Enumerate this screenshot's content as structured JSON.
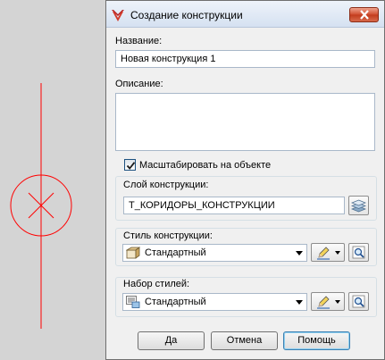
{
  "window": {
    "title": "Создание конструкции"
  },
  "fields": {
    "name_label": "Название:",
    "name_value": "Новая конструкция 1",
    "description_label": "Описание:",
    "description_value": "",
    "scale_checkbox_label": "Масштабировать на объекте",
    "scale_checked": true,
    "layer_label": "Слой конструкции:",
    "layer_value": "Т_КОРИДОРЫ_КОНСТРУКЦИИ",
    "style_label": "Стиль конструкции:",
    "style_value": "Стандартный",
    "styleset_label": "Набор стилей:",
    "styleset_value": "Стандартный"
  },
  "buttons": {
    "ok": "Да",
    "cancel": "Отмена",
    "help": "Помощь"
  },
  "icons": {
    "app": "civil3d-app-icon",
    "close": "close-icon",
    "layer": "layers-icon",
    "style": "structure-style-icon",
    "styleset": "style-set-icon",
    "edit": "pencil-edit-icon",
    "preview": "magnifier-icon"
  },
  "colors": {
    "drawing_line": "#ff0000",
    "dialog_bg": "#f0f0f0",
    "close_button": "#c7442a"
  }
}
